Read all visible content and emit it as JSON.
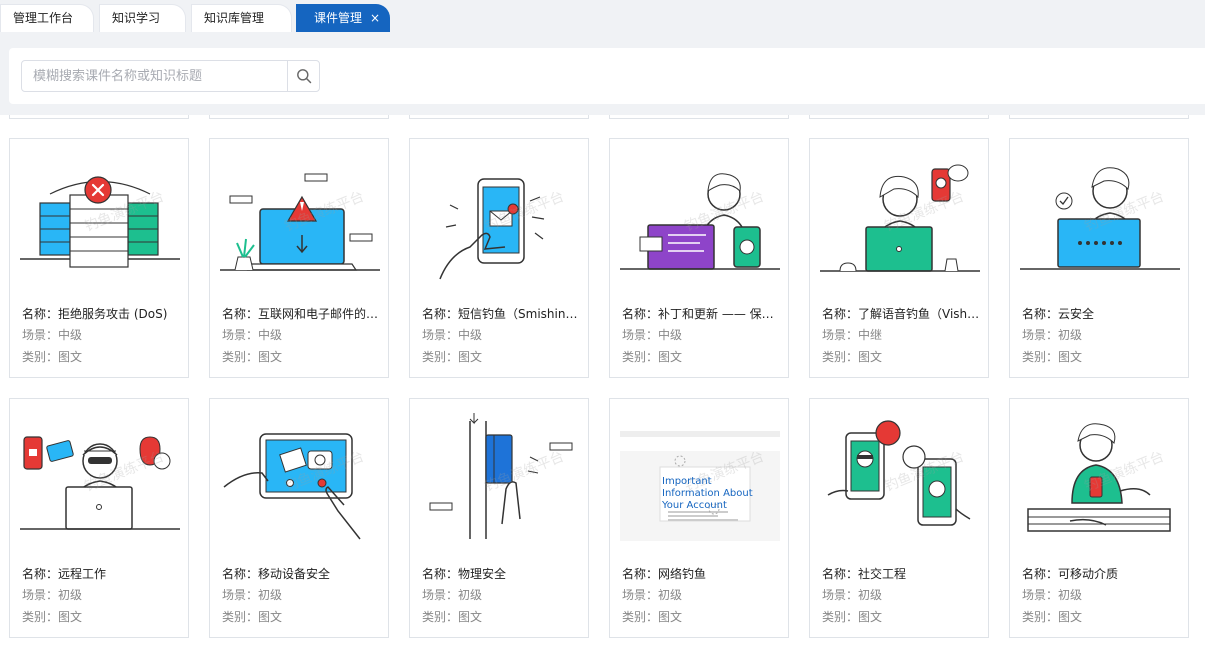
{
  "tabs": [
    {
      "label": "管理工作台",
      "active": false
    },
    {
      "label": "知识学习",
      "active": false
    },
    {
      "label": "知识库管理",
      "active": false
    },
    {
      "label": "课件管理",
      "active": true,
      "close": "×"
    }
  ],
  "search": {
    "placeholder": "模糊搜索课件名称或知识标题",
    "icon": "search-icon"
  },
  "field_labels": {
    "name": "名称：",
    "scene": "场景：",
    "category": "类别："
  },
  "watermark": "钓鱼演练平台",
  "courses": [
    {
      "name": "拒绝服务攻击 (DoS)",
      "scene": "中级",
      "category": "图文",
      "illustration": "server-rack-error"
    },
    {
      "name": "互联网和电子邮件的安全使用",
      "scene": "中级",
      "category": "图文",
      "illustration": "laptop-free-warning"
    },
    {
      "name": "短信钓鱼（Smishing）",
      "scene": "中级",
      "category": "图文",
      "illustration": "phone-sms-message"
    },
    {
      "name": "补丁和更新 —— 保持系统更新",
      "scene": "中级",
      "category": "图文",
      "illustration": "person-laptop-code"
    },
    {
      "name": "了解语音钓鱼（Vishing）",
      "scene": "中继",
      "category": "图文",
      "illustration": "person-phone-call"
    },
    {
      "name": "云安全",
      "scene": "初级",
      "category": "图文",
      "illustration": "person-password-laptop"
    },
    {
      "name": "远程工作",
      "scene": "初级",
      "category": "图文",
      "illustration": "hacker-laptop"
    },
    {
      "name": "移动设备安全",
      "scene": "初级",
      "category": "图文",
      "illustration": "tablet-photos"
    },
    {
      "name": "物理安全",
      "scene": "初级",
      "category": "图文",
      "illustration": "hand-access-card"
    },
    {
      "name": "网络钓鱼",
      "scene": "初级",
      "category": "图文",
      "illustration": "phishing-email-screenshot"
    },
    {
      "name": "社交工程",
      "scene": "初级",
      "category": "图文",
      "illustration": "phones-conversation"
    },
    {
      "name": "可移动介质",
      "scene": "初级",
      "category": "图文",
      "illustration": "person-phone-couch"
    }
  ],
  "email_preview": {
    "subject": "Important Information About Your Account"
  },
  "colors": {
    "accent": "#1565c0",
    "illus_blue": "#29b6f6",
    "illus_green": "#1dbf8f",
    "illus_red": "#e53935",
    "illus_purple": "#8e44c9"
  }
}
